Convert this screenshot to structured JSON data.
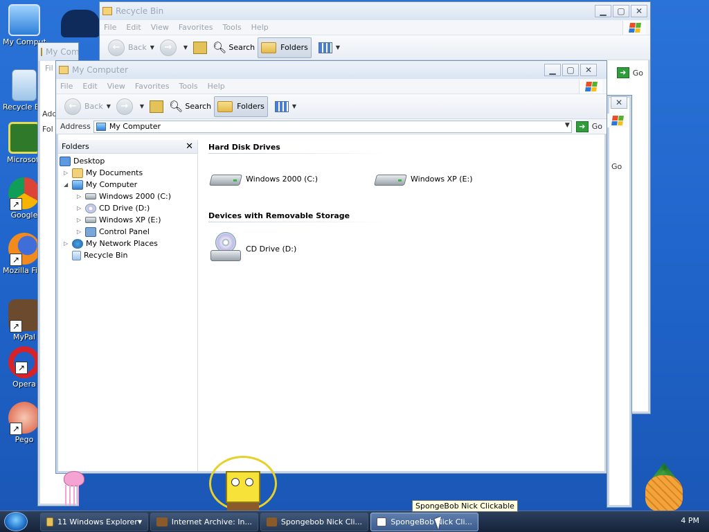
{
  "desktop": {
    "icons": [
      {
        "label": "My Computer"
      },
      {
        "label": "Recycle Bin"
      },
      {
        "label": "Microsoft"
      },
      {
        "label": "Google"
      },
      {
        "label": "Mozilla Firefox"
      },
      {
        "label": "MyPal"
      },
      {
        "label": "Opera"
      },
      {
        "label": "Pego"
      }
    ]
  },
  "window_recycle": {
    "title": "Recycle Bin",
    "menu": [
      "File",
      "Edit",
      "View",
      "Favorites",
      "Tools",
      "Help"
    ],
    "toolbar": {
      "back": "Back",
      "search": "Search",
      "folders": "Folders"
    },
    "go": "Go"
  },
  "window_mycomputer_back": {
    "title": "My Computer",
    "menu_partial": "Fil",
    "address_partial": "Add",
    "folders_partial": "Fol",
    "go": "Go"
  },
  "window_small_right": {
    "go": "Go"
  },
  "window_front": {
    "title": "My Computer",
    "menu": [
      "File",
      "Edit",
      "View",
      "Favorites",
      "Tools",
      "Help"
    ],
    "toolbar": {
      "back": "Back",
      "search": "Search",
      "folders": "Folders"
    },
    "address": {
      "label": "Address",
      "value": "My Computer",
      "go": "Go"
    },
    "folders_pane": {
      "title": "Folders",
      "tree": [
        {
          "label": "Desktop"
        },
        {
          "label": "My Documents"
        },
        {
          "label": "My Computer"
        },
        {
          "label": "Windows 2000 (C:)"
        },
        {
          "label": "CD Drive (D:)"
        },
        {
          "label": "Windows XP (E:)"
        },
        {
          "label": "Control Panel"
        },
        {
          "label": "My Network Places"
        },
        {
          "label": "Recycle Bin"
        }
      ]
    },
    "groups": [
      {
        "title": "Hard Disk Drives",
        "items": [
          "Windows 2000 (C:)",
          "Windows XP (E:)"
        ]
      },
      {
        "title": "Devices with Removable Storage",
        "items": [
          "CD Drive (D:)"
        ]
      }
    ]
  },
  "taskbar": {
    "buttons": [
      {
        "label": "11 Windows Explorer"
      },
      {
        "label": "Internet Archive: In..."
      },
      {
        "label": "Spongebob Nick Cli..."
      },
      {
        "label": "SpongeBob Nick Cli..."
      }
    ],
    "tooltip": "SpongeBob Nick Clickable",
    "clock": "4 PM"
  },
  "colors": {
    "desktop": "#1f63c9",
    "taskbar": "#1b2c47",
    "accent": "#2e9e3a"
  }
}
